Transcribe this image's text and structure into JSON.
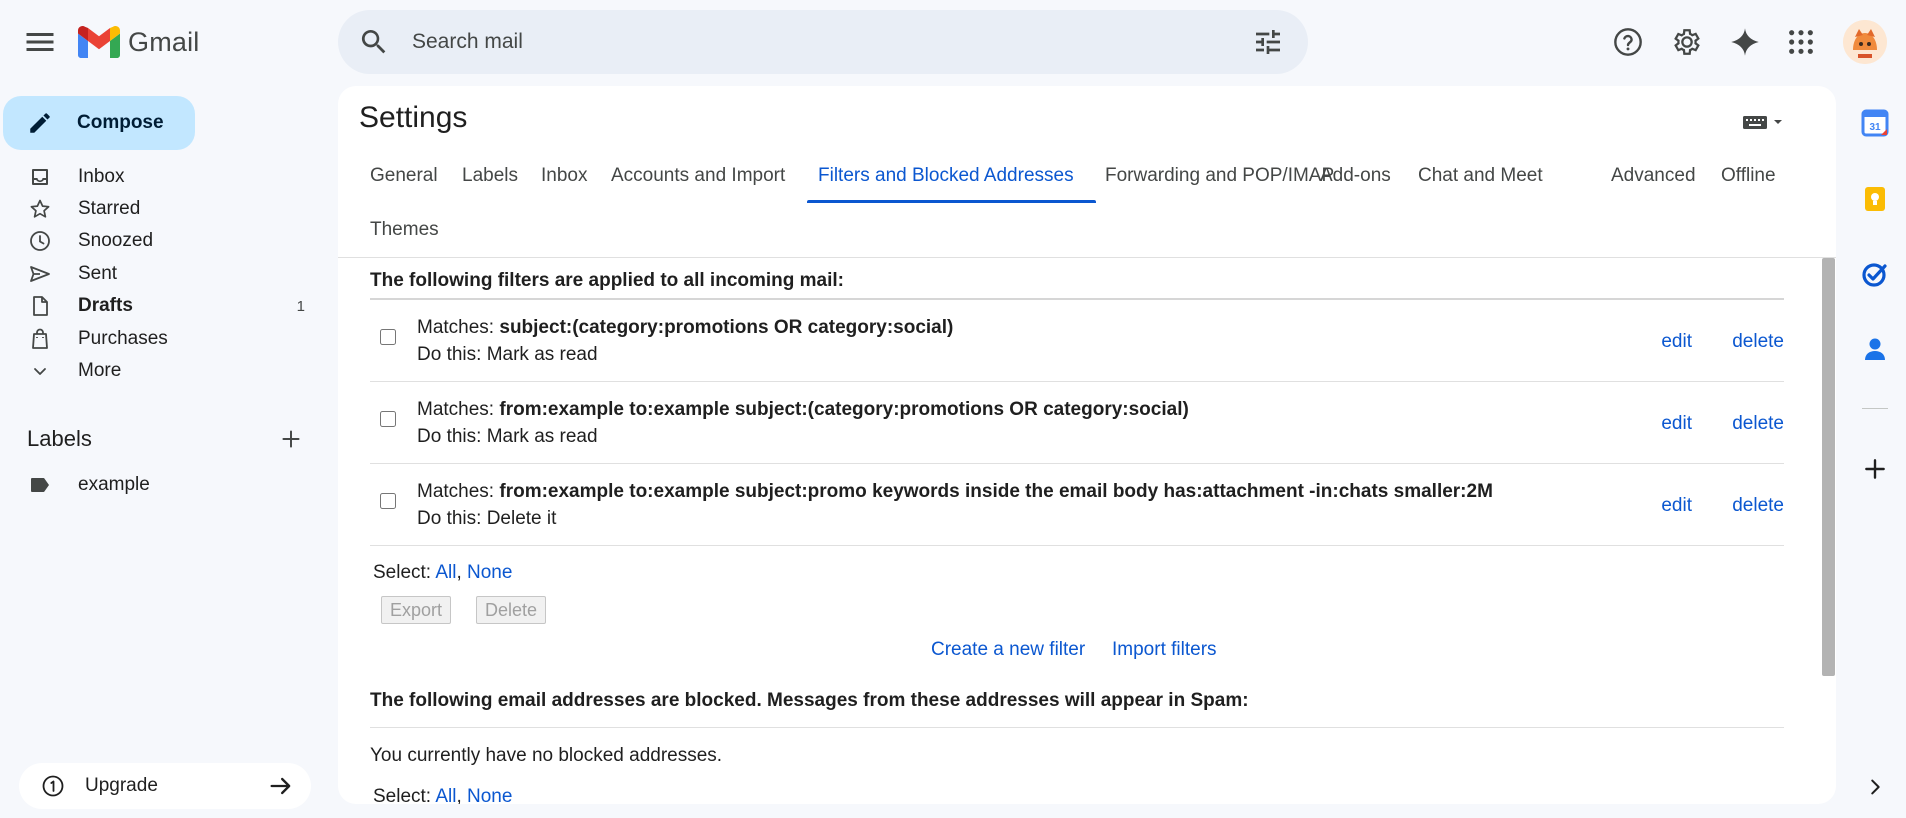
{
  "app": {
    "name": "Gmail"
  },
  "search": {
    "placeholder": "Search mail"
  },
  "nav": {
    "compose": "Compose",
    "items": [
      {
        "label": "Inbox",
        "icon": "inbox-icon"
      },
      {
        "label": "Starred",
        "icon": "star-icon"
      },
      {
        "label": "Snoozed",
        "icon": "clock-icon"
      },
      {
        "label": "Sent",
        "icon": "send-icon"
      },
      {
        "label": "Drafts",
        "icon": "draft-icon",
        "count": "1"
      },
      {
        "label": "Purchases",
        "icon": "shopping-bag-icon"
      },
      {
        "label": "More",
        "icon": "chevron-down-icon"
      }
    ],
    "labels_title": "Labels",
    "labels": [
      {
        "name": "example",
        "icon": "label-icon"
      }
    ],
    "upgrade": "Upgrade"
  },
  "settings": {
    "title": "Settings",
    "tabs": [
      "General",
      "Labels",
      "Inbox",
      "Accounts and Import",
      "Filters and Blocked Addresses",
      "Forwarding and POP/IMAP",
      "Add-ons",
      "Chat and Meet",
      "Advanced",
      "Offline",
      "Themes"
    ],
    "active_tab": "Filters and Blocked Addresses",
    "filters_heading": "The following filters are applied to all incoming mail:",
    "filters": [
      {
        "matches_label": "Matches: ",
        "criteria": "subject:(category:promotions OR category:social)",
        "action": "Do this: Mark as read"
      },
      {
        "matches_label": "Matches: ",
        "criteria": "from:example to:example subject:(category:promotions OR category:social)",
        "action": "Do this: Mark as read"
      },
      {
        "matches_label": "Matches: ",
        "criteria": "from:example to:example subject:promo keywords inside the email body has:attachment -in:chats smaller:2M",
        "action": "Do this: Delete it"
      }
    ],
    "edit_label": "edit",
    "delete_label": "delete",
    "select": {
      "prefix": "Select: ",
      "all": "All",
      "sep": ", ",
      "none": "None"
    },
    "export_button": "Export",
    "delete_button": "Delete",
    "create_filter": "Create a new filter",
    "import_filters": "Import filters",
    "blocked_heading": "The following email addresses are blocked. Messages from these addresses will appear in Spam:",
    "no_blocked": "You currently have no blocked addresses."
  },
  "side_panel": {
    "calendar_day": "31",
    "icons": [
      "calendar-icon",
      "keep-icon",
      "tasks-icon",
      "contacts-icon",
      "add-icon"
    ]
  },
  "colors": {
    "accent": "#0b57d0",
    "compose_bg": "#c2e7ff",
    "page_bg": "#f6f8fc"
  }
}
